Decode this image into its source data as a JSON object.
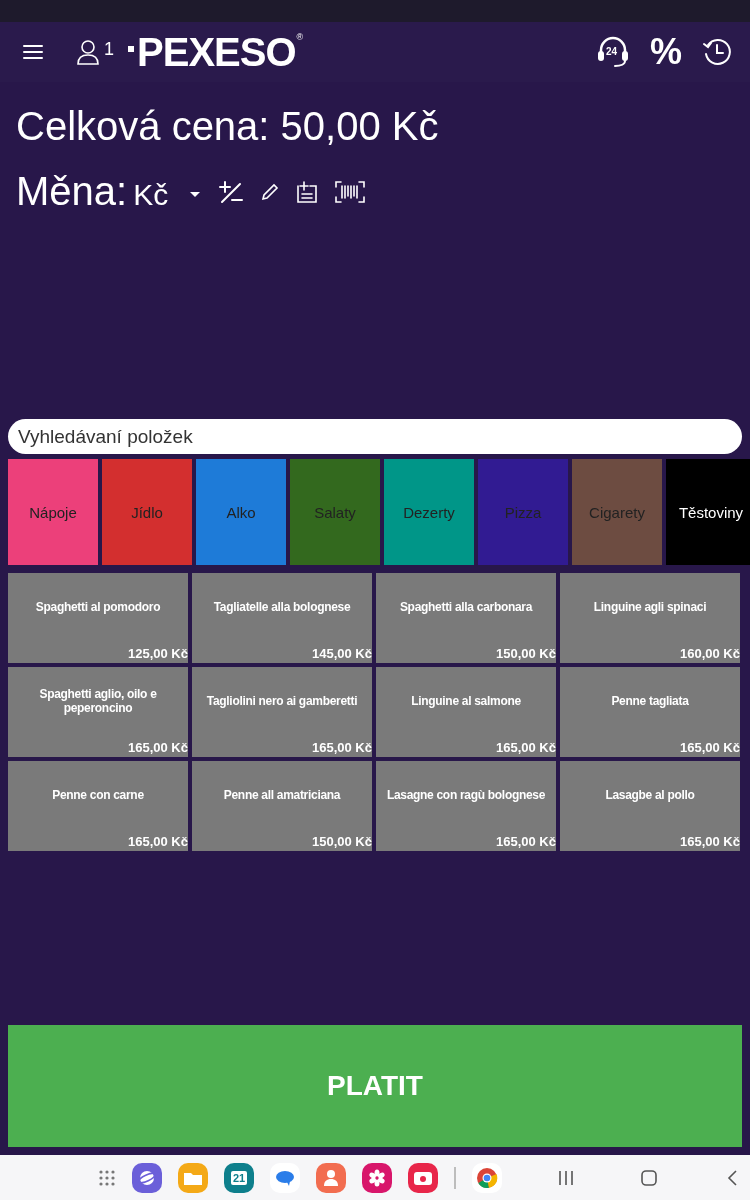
{
  "header": {
    "user_count": "1",
    "logo": "PEXESO",
    "logo_mark": "®",
    "support_label": "24",
    "discount_label": "%"
  },
  "total": {
    "label": "Celková cena:",
    "value": "50,00 Kč"
  },
  "currency": {
    "label": "Měna:",
    "value": "Kč"
  },
  "search": {
    "placeholder": "Vyhledávaní položek"
  },
  "categories": [
    {
      "label": "Nápoje",
      "color": "#ec407a"
    },
    {
      "label": "Jídlo",
      "color": "#d32f2f"
    },
    {
      "label": "Alko",
      "color": "#1e7bd8"
    },
    {
      "label": "Salaty",
      "color": "#33691e"
    },
    {
      "label": "Dezerty",
      "color": "#009688"
    },
    {
      "label": "Pizza",
      "color": "#311b92"
    },
    {
      "label": "Cigarety",
      "color": "#6d4c41"
    },
    {
      "label": "Těstoviny",
      "color": "#000000"
    }
  ],
  "products": [
    {
      "name": "Spaghetti al pomodoro",
      "price": "125,00 Kč"
    },
    {
      "name": "Tagliatelle alla bolognese",
      "price": "145,00 Kč"
    },
    {
      "name": "Spaghetti alla carbonara",
      "price": "150,00 Kč"
    },
    {
      "name": "Linguine agli spinaci",
      "price": "160,00 Kč"
    },
    {
      "name": "Spaghetti aglio, oilo e peperoncino",
      "price": "165,00 Kč"
    },
    {
      "name": "Tagliolini nero ai gamberetti",
      "price": "165,00 Kč"
    },
    {
      "name": "Linguine al salmone",
      "price": "165,00 Kč"
    },
    {
      "name": "Penne tagliata",
      "price": "165,00 Kč"
    },
    {
      "name": "Penne con carne",
      "price": "165,00 Kč"
    },
    {
      "name": "Penne all amatriciana",
      "price": "150,00 Kč"
    },
    {
      "name": "Lasagne con ragù bolognese",
      "price": "165,00 Kč"
    },
    {
      "name": "Lasagbe al pollo",
      "price": "165,00 Kč"
    }
  ],
  "pay_button": "PLATIT",
  "taskbar": {
    "calendar_day": "21"
  }
}
